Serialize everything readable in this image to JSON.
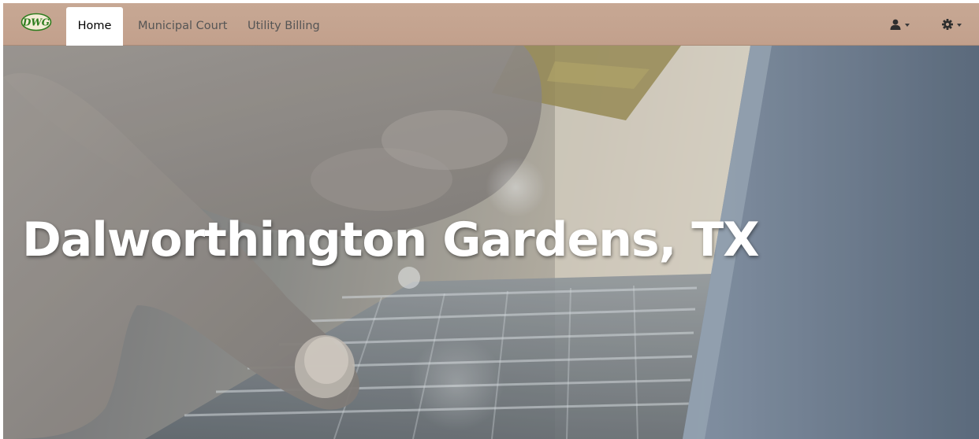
{
  "navbar": {
    "logo_icon": "dwg-logo-icon",
    "logo_text": "DWG",
    "tabs": [
      {
        "label": "Home",
        "active": true
      },
      {
        "label": "Municipal Court",
        "active": false
      },
      {
        "label": "Utility Billing",
        "active": false
      }
    ],
    "user_menu_icon": "user-icon",
    "settings_menu_icon": "gear-icon"
  },
  "hero": {
    "title": "Dalworthington Gardens, TX",
    "background_image": "hand typing on laptop keyboard holding credit card"
  },
  "colors": {
    "navbar_background": "#c4a490",
    "active_tab_background": "#ffffff",
    "logo_green": "#2e7d1e",
    "hero_title": "#ffffff"
  }
}
